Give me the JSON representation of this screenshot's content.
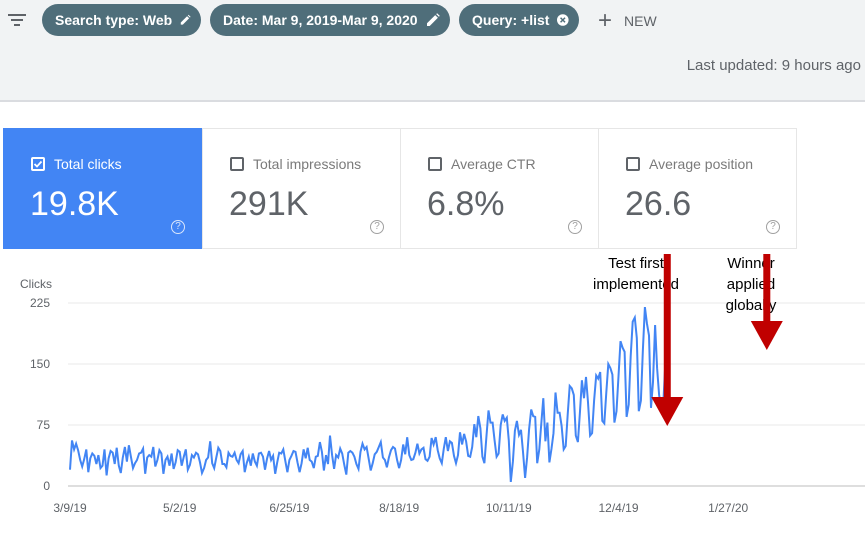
{
  "toolbar": {
    "chips": [
      {
        "label": "Search type: Web",
        "icon": "pencil-icon"
      },
      {
        "label": "Date: Mar 9, 2019-Mar 9, 2020",
        "icon": "pencil-icon"
      },
      {
        "label": "Query: +list",
        "icon": "close-circle-icon"
      }
    ],
    "new_label": "NEW",
    "last_updated": "Last updated: 9 hours ago"
  },
  "metrics": [
    {
      "label": "Total clicks",
      "value": "19.8K",
      "selected": true,
      "color": "#4285f4"
    },
    {
      "label": "Total impressions",
      "value": "291K",
      "selected": false
    },
    {
      "label": "Average CTR",
      "value": "6.8%",
      "selected": false
    },
    {
      "label": "Average position",
      "value": "26.6",
      "selected": false
    }
  ],
  "chart_data": {
    "type": "line",
    "ylabel": "Clicks",
    "ylim": [
      0,
      225
    ],
    "yticks": [
      0,
      75,
      150,
      225
    ],
    "x_start": "3/9/19",
    "x_tick_labels": [
      "3/9/19",
      "5/2/19",
      "6/25/19",
      "8/18/19",
      "10/11/19",
      "12/4/19",
      "1/27/20"
    ],
    "grid": true,
    "series": [
      {
        "color": "#4285f4",
        "values": [
          20,
          56,
          45,
          52,
          44,
          32,
          24,
          33,
          45,
          17,
          34,
          40,
          37,
          27,
          38,
          22,
          25,
          45,
          13,
          34,
          43,
          41,
          27,
          47,
          25,
          16,
          35,
          48,
          30,
          50,
          36,
          22,
          28,
          32,
          40,
          41,
          46,
          15,
          35,
          38,
          36,
          48,
          24,
          32,
          44,
          40,
          15,
          32,
          36,
          25,
          40,
          21,
          29,
          44,
          42,
          25,
          36,
          45,
          20,
          26,
          38,
          35,
          41,
          39,
          29,
          16,
          22,
          32,
          35,
          55,
          28,
          22,
          35,
          47,
          43,
          27,
          27,
          23,
          41,
          37,
          36,
          41,
          32,
          28,
          39,
          43,
          17,
          28,
          36,
          25,
          40,
          30,
          25,
          40,
          41,
          36,
          20,
          34,
          43,
          32,
          37,
          15,
          29,
          41,
          40,
          45,
          31,
          17,
          32,
          37,
          43,
          42,
          29,
          17,
          28,
          45,
          34,
          47,
          32,
          30,
          22,
          36,
          37,
          54,
          42,
          19,
          38,
          27,
          62,
          38,
          21,
          38,
          35,
          46,
          40,
          26,
          14,
          41,
          43,
          41,
          36,
          27,
          21,
          42,
          52,
          45,
          48,
          34,
          19,
          28,
          39,
          42,
          48,
          54,
          35,
          32,
          23,
          35,
          44,
          48,
          46,
          32,
          22,
          32,
          51,
          39,
          60,
          38,
          32,
          33,
          41,
          52,
          40,
          45,
          47,
          33,
          31,
          36,
          59,
          51,
          60,
          44,
          34,
          28,
          46,
          60,
          43,
          55,
          53,
          37,
          28,
          38,
          66,
          51,
          64,
          55,
          37,
          36,
          48,
          76,
          60,
          86,
          71,
          36,
          28,
          62,
          93,
          78,
          78,
          56,
          36,
          40,
          75,
          88,
          80,
          84,
          56,
          5,
          30,
          68,
          80,
          63,
          69,
          42,
          10,
          35,
          70,
          94,
          86,
          85,
          28,
          45,
          77,
          108,
          55,
          78,
          29,
          46,
          65,
          115,
          90,
          90,
          74,
          45,
          49,
          88,
          123,
          120,
          112,
          62,
          54,
          90,
          130,
          108,
          134,
          103,
          62,
          65,
          105,
          136,
          132,
          140,
          80,
          77,
          115,
          150,
          145,
          137,
          78,
          92,
          135,
          178,
          170,
          165,
          85,
          100,
          160,
          202,
          207,
          182,
          92,
          105,
          168,
          220,
          200,
          185,
          96,
          128,
          198,
          145,
          112,
          96,
          99,
          148
        ]
      }
    ],
    "annotations": [
      {
        "text_lines": [
          "Test first",
          "implemented"
        ],
        "date": "12/28/19",
        "color": "#c00000"
      },
      {
        "text_lines": [
          "Winner",
          "applied",
          "globally"
        ],
        "date": "2/15/20",
        "color": "#c00000"
      }
    ]
  }
}
